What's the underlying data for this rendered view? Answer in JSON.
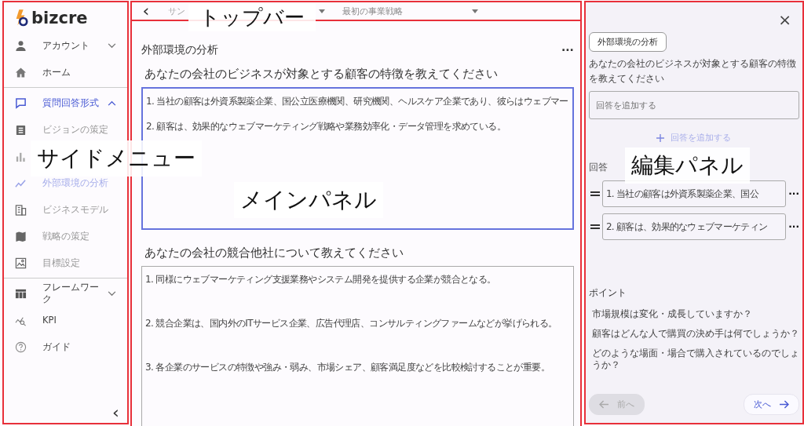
{
  "logo": "bizcre",
  "sidebar": {
    "items": [
      {
        "label": "アカウント",
        "expanded": false,
        "selected": false
      },
      {
        "label": "ホーム",
        "selected": false
      },
      {
        "label": "質問回答形式",
        "expanded": true,
        "selected": true,
        "divider_before": true,
        "children": [
          {
            "label": "ビジョンの策定",
            "selected": false
          },
          {
            "selected": false
          },
          {
            "label": "外部環境の分析",
            "selected": true
          },
          {
            "label": "ビジネスモデル",
            "selected": false
          },
          {
            "label": "戦略の策定",
            "selected": false
          },
          {
            "label": "目標設定",
            "selected": false
          }
        ]
      },
      {
        "label": "フレームワーク",
        "expanded": false,
        "selected": false,
        "divider_before": true
      },
      {
        "label": "KPI",
        "selected": false
      },
      {
        "label": "ガイド",
        "selected": false
      }
    ],
    "collapse": "‹"
  },
  "topbar": {
    "back": "‹",
    "selects": [
      {
        "value": "サン"
      },
      {
        "value": "最初の事業戦略"
      }
    ]
  },
  "main": {
    "title": "外部環境の分析",
    "menu": "···",
    "questions": [
      {
        "question": "あなたの会社のビジネスが対象とする顧客の特徴を教えてください",
        "focused": true,
        "answers": [
          "1. 当社の顧客は外資系製薬企業、国公立医療機関、研究機関、ヘルスケア企業であり、彼らはウェブマー",
          "2. 顧客は、効果的なウェブマーケティング戦略や業務効率化・データ管理を求めている。"
        ]
      },
      {
        "question": "あなたの会社の競合他社について教えてください",
        "focused": false,
        "answers": [
          "1. 同様にウェブマーケティング支援業務やシステム開発を提供する企業が競合となる。",
          "2. 競合企業は、国内外のITサービス企業、広告代理店、コンサルティングファームなどが挙げられる。",
          "3. 各企業のサービスの特徴や強み・弱み、市場シェア、顧客満足度などを比較検討することが重要。"
        ]
      }
    ]
  },
  "edit_panel": {
    "close": "×",
    "tag": "外部環境の分析",
    "question": "あなたの会社のビジネスが対象とする顧客の特徴を教えてください",
    "input": {
      "placeholder": "回答を追加する"
    },
    "add_button": "回答を追加する",
    "answers_label": "回答",
    "answers": [
      {
        "text": "1.  当社の顧客は外資系製薬企業、国公"
      },
      {
        "text": "2.  顧客は、効果的なウェブマーケティン"
      }
    ],
    "points_title": "ポイント",
    "points": [
      "市場規模は変化・成長していますか？",
      "顧客はどんな人で購買の決め手は何でしょうか？",
      "どのような場面・場合で購入されているのでしょうか？"
    ],
    "prev": {
      "label": "前へ",
      "disabled": true
    },
    "next": {
      "label": "次へ",
      "disabled": false
    }
  },
  "annotations": [
    {
      "label": "サイドメニュー"
    },
    {
      "label": "トップバー"
    },
    {
      "label": "メインパネル"
    },
    {
      "label": "編集パネル"
    }
  ]
}
